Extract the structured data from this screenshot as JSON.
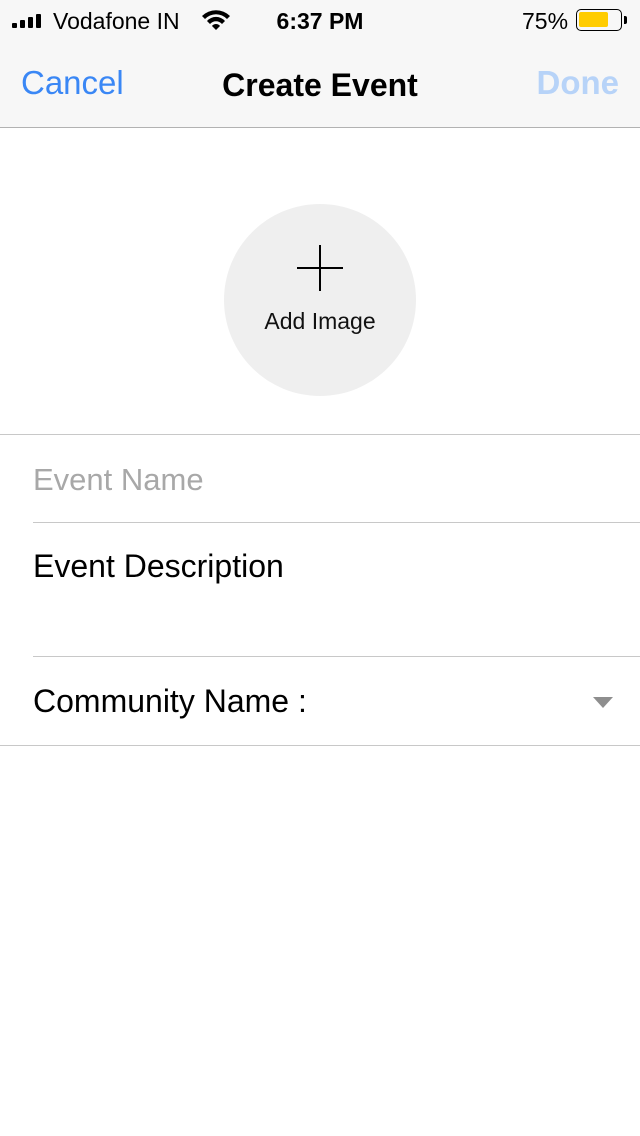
{
  "status_bar": {
    "carrier": "Vodafone IN",
    "time": "6:37 PM",
    "battery_percent": "75%",
    "battery_level": 0.75,
    "battery_color": "#ffcc00",
    "signal_icon": "cellular-signal-icon",
    "wifi_icon": "wifi-icon"
  },
  "nav": {
    "cancel_label": "Cancel",
    "title": "Create Event",
    "done_label": "Done",
    "accent_color": "#3a87f5"
  },
  "add_image": {
    "label": "Add Image",
    "icon": "plus-icon"
  },
  "form": {
    "event_name_placeholder": "Event Name",
    "event_name_value": "",
    "event_description": "Event Description",
    "community_label": "Community Name :",
    "community_icon": "chevron-down-icon"
  }
}
